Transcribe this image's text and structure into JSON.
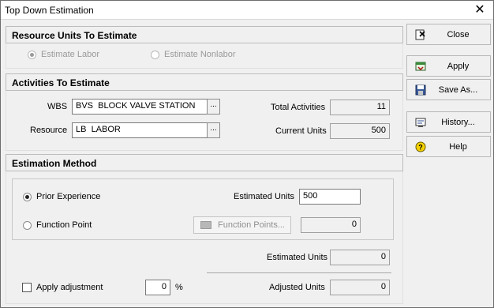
{
  "window": {
    "title": "Top Down Estimation",
    "close_glyph": "✕"
  },
  "resource_units": {
    "header": "Resource Units To Estimate",
    "estimate_labor": "Estimate Labor",
    "estimate_nonlabor": "Estimate Nonlabor",
    "selected": "estimate_labor"
  },
  "activities": {
    "header": "Activities To Estimate",
    "wbs_label": "WBS",
    "wbs_value": "BVS  BLOCK VALVE STATION",
    "resource_label": "Resource",
    "resource_value": "LB  LABOR",
    "browse_label": "...",
    "total_activities_label": "Total Activities",
    "total_activities_value": "11",
    "current_units_label": "Current Units",
    "current_units_value": "500"
  },
  "estimation_method": {
    "header": "Estimation Method",
    "prior_experience": "Prior Experience",
    "function_point": "Function Point",
    "selected": "prior_experience",
    "estimated_units_label": "Estimated Units",
    "estimated_units_value": "500",
    "function_points_button": "Function Points...",
    "function_points_value": "0",
    "estimated_units_label_2": "Estimated Units",
    "estimated_units_value_2": "0",
    "apply_adjustment": "Apply adjustment",
    "adjustment_value": "0",
    "adjustment_unit": "%",
    "adjusted_units_label": "Adjusted Units",
    "adjusted_units_value": "0"
  },
  "sidebar": {
    "close": "Close",
    "apply": "Apply",
    "save_as": "Save As...",
    "history": "History...",
    "help": "Help"
  },
  "icons": {
    "close": "close-document-icon",
    "apply": "apply-icon",
    "save_as": "floppy-disk-icon",
    "history": "history-icon",
    "help": "help-question-icon"
  }
}
